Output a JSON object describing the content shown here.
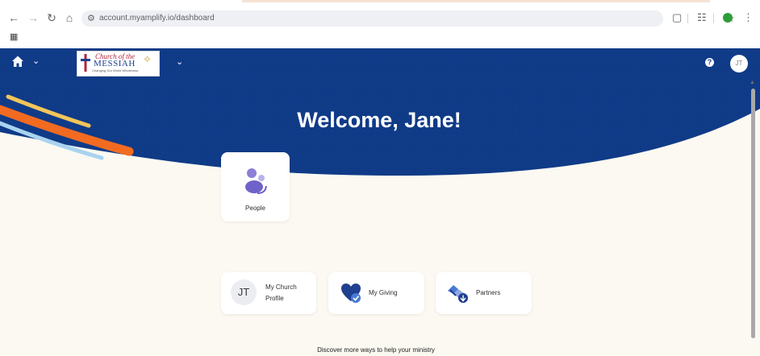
{
  "browser": {
    "url": "account.myamplify.io/dashboard",
    "profile_color": "#2e9d3a",
    "icons": [
      "back-arrow-icon",
      "forward-arrow-icon",
      "reload-icon",
      "home-icon",
      "site-info-icon",
      "star-icon",
      "extensions-icon",
      "reading-list-icon",
      "menu-kebab-icon",
      "apps-grid-icon"
    ]
  },
  "header": {
    "logo": {
      "line1": "Church of the",
      "line2": "MESSIAH",
      "line3": "Changing Our World Wholeness"
    },
    "help_label": "?",
    "avatar_initials": "JT",
    "brand_color": "#0f3a86"
  },
  "hero": {
    "welcome": "Welcome, Jane!",
    "stripe_colors": [
      "#f2c55a",
      "#f26b21",
      "#a9d3f0"
    ]
  },
  "cards": {
    "people": {
      "label": "People",
      "icon": "people-icon"
    },
    "profile": {
      "initials": "JT",
      "label_line1": "My Church",
      "label_line2": "Profile"
    },
    "giving": {
      "label": "My Giving",
      "icon": "heart-hand-icon"
    },
    "partners": {
      "label": "Partners",
      "icon": "handshake-icon"
    }
  },
  "footer": {
    "discover": "Discover more ways to help your ministry"
  },
  "colors": {
    "background": "#fbf9f1",
    "accent_blue": "#0f3a86"
  }
}
